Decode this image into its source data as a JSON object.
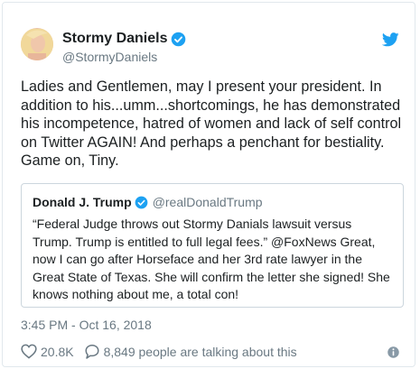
{
  "author": {
    "display_name": "Stormy Daniels",
    "handle": "@StormyDaniels",
    "verified": true
  },
  "tweet": {
    "text": "Ladies and Gentlemen,  may I present your president. In addition to his...umm...shortcomings, he has demonstrated his incompetence, hatred of women and lack of self control on Twitter AGAIN! And perhaps a penchant for bestiality. Game on, Tiny."
  },
  "quoted_tweet": {
    "display_name": "Donald J. Trump",
    "handle": "@realDonaldTrump",
    "verified": true,
    "text": "“Federal Judge throws out Stormy Danials lawsuit versus Trump. Trump is entitled to full legal fees.” @FoxNews Great, now I can go after Horseface and her 3rd rate lawyer in the Great State of Texas. She will confirm the letter she signed! She knows nothing about me, a total con!"
  },
  "timestamp": "3:45 PM - Oct 16, 2018",
  "engagement": {
    "likes": "20.8K",
    "talking": "8,849 people are talking about this"
  },
  "icons": {
    "brand": "twitter-bird-icon",
    "verified": "verified-badge-icon",
    "like": "heart-icon",
    "reply": "speech-bubble-icon",
    "info": "info-icon"
  },
  "colors": {
    "twitter_blue": "#1da1f2",
    "text": "#1c2022",
    "secondary": "#697882",
    "border": "#e1e8ed"
  }
}
